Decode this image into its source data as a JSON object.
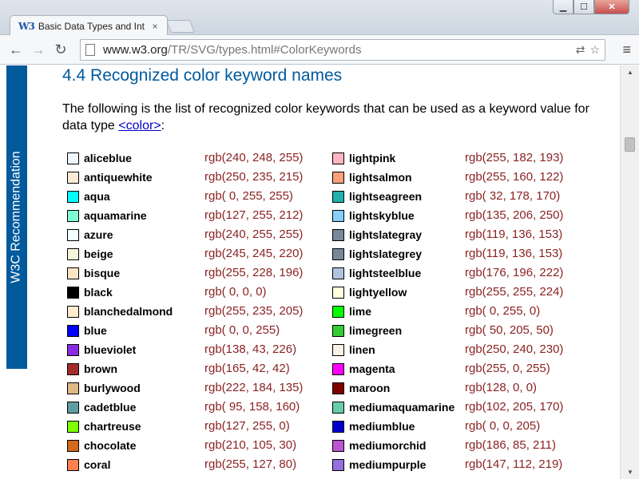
{
  "browser": {
    "tab_favicon": "W3",
    "tab_title": "Basic Data Types and Inter",
    "tab_close": "×",
    "url_host": "www.w3.org",
    "url_path": "/TR/SVG/types.html#ColorKeywords",
    "back_glyph": "←",
    "forward_glyph": "→",
    "reload_glyph": "↻",
    "translate_glyph": "⇄",
    "star_glyph": "☆",
    "menu_glyph": "≡",
    "min_glyph": "▁",
    "max_glyph": "☐",
    "close_glyph": "✕"
  },
  "sidebar": {
    "label": "W3C Recommendation"
  },
  "page": {
    "heading": "4.4 Recognized color keyword names",
    "intro_text": "The following is the list of recognized color keywords that can be used as a keyword value for data type ",
    "intro_link": "<color>",
    "intro_end": ":"
  },
  "colors_left": [
    {
      "name": "aliceblue",
      "rgb": "rgb(240, 248, 255)",
      "hex": "#f0f8ff"
    },
    {
      "name": "antiquewhite",
      "rgb": "rgb(250, 235, 215)",
      "hex": "#faebd7"
    },
    {
      "name": "aqua",
      "rgb": "rgb( 0, 255, 255)",
      "hex": "#00ffff"
    },
    {
      "name": "aquamarine",
      "rgb": "rgb(127, 255, 212)",
      "hex": "#7fffd4"
    },
    {
      "name": "azure",
      "rgb": "rgb(240, 255, 255)",
      "hex": "#f0ffff"
    },
    {
      "name": "beige",
      "rgb": "rgb(245, 245, 220)",
      "hex": "#f5f5dc"
    },
    {
      "name": "bisque",
      "rgb": "rgb(255, 228, 196)",
      "hex": "#ffe4c4"
    },
    {
      "name": "black",
      "rgb": "rgb( 0, 0, 0)",
      "hex": "#000000"
    },
    {
      "name": "blanchedalmond",
      "rgb": "rgb(255, 235, 205)",
      "hex": "#ffebcd"
    },
    {
      "name": "blue",
      "rgb": "rgb( 0, 0, 255)",
      "hex": "#0000ff"
    },
    {
      "name": "blueviolet",
      "rgb": "rgb(138, 43, 226)",
      "hex": "#8a2be2"
    },
    {
      "name": "brown",
      "rgb": "rgb(165, 42, 42)",
      "hex": "#a52a2a"
    },
    {
      "name": "burlywood",
      "rgb": "rgb(222, 184, 135)",
      "hex": "#deb887"
    },
    {
      "name": "cadetblue",
      "rgb": "rgb( 95, 158, 160)",
      "hex": "#5f9ea0"
    },
    {
      "name": "chartreuse",
      "rgb": "rgb(127, 255, 0)",
      "hex": "#7fff00"
    },
    {
      "name": "chocolate",
      "rgb": "rgb(210, 105, 30)",
      "hex": "#d2691e"
    },
    {
      "name": "coral",
      "rgb": "rgb(255, 127, 80)",
      "hex": "#ff7f50"
    }
  ],
  "colors_right": [
    {
      "name": "lightpink",
      "rgb": "rgb(255, 182, 193)",
      "hex": "#ffb6c1"
    },
    {
      "name": "lightsalmon",
      "rgb": "rgb(255, 160, 122)",
      "hex": "#ffa07a"
    },
    {
      "name": "lightseagreen",
      "rgb": "rgb( 32, 178, 170)",
      "hex": "#20b2aa"
    },
    {
      "name": "lightskyblue",
      "rgb": "rgb(135, 206, 250)",
      "hex": "#87cefa"
    },
    {
      "name": "lightslategray",
      "rgb": "rgb(119, 136, 153)",
      "hex": "#778899"
    },
    {
      "name": "lightslategrey",
      "rgb": "rgb(119, 136, 153)",
      "hex": "#778899"
    },
    {
      "name": "lightsteelblue",
      "rgb": "rgb(176, 196, 222)",
      "hex": "#b0c4de"
    },
    {
      "name": "lightyellow",
      "rgb": "rgb(255, 255, 224)",
      "hex": "#ffffe0"
    },
    {
      "name": "lime",
      "rgb": "rgb( 0, 255, 0)",
      "hex": "#00ff00"
    },
    {
      "name": "limegreen",
      "rgb": "rgb( 50, 205, 50)",
      "hex": "#32cd32"
    },
    {
      "name": "linen",
      "rgb": "rgb(250, 240, 230)",
      "hex": "#faf0e6"
    },
    {
      "name": "magenta",
      "rgb": "rgb(255, 0, 255)",
      "hex": "#ff00ff"
    },
    {
      "name": "maroon",
      "rgb": "rgb(128, 0, 0)",
      "hex": "#800000"
    },
    {
      "name": "mediumaquamarine",
      "rgb": "rgb(102, 205, 170)",
      "hex": "#66cdaa"
    },
    {
      "name": "mediumblue",
      "rgb": "rgb( 0, 0, 205)",
      "hex": "#0000cd"
    },
    {
      "name": "mediumorchid",
      "rgb": "rgb(186, 85, 211)",
      "hex": "#ba55d3"
    },
    {
      "name": "mediumpurple",
      "rgb": "rgb(147, 112, 219)",
      "hex": "#9370db"
    }
  ]
}
